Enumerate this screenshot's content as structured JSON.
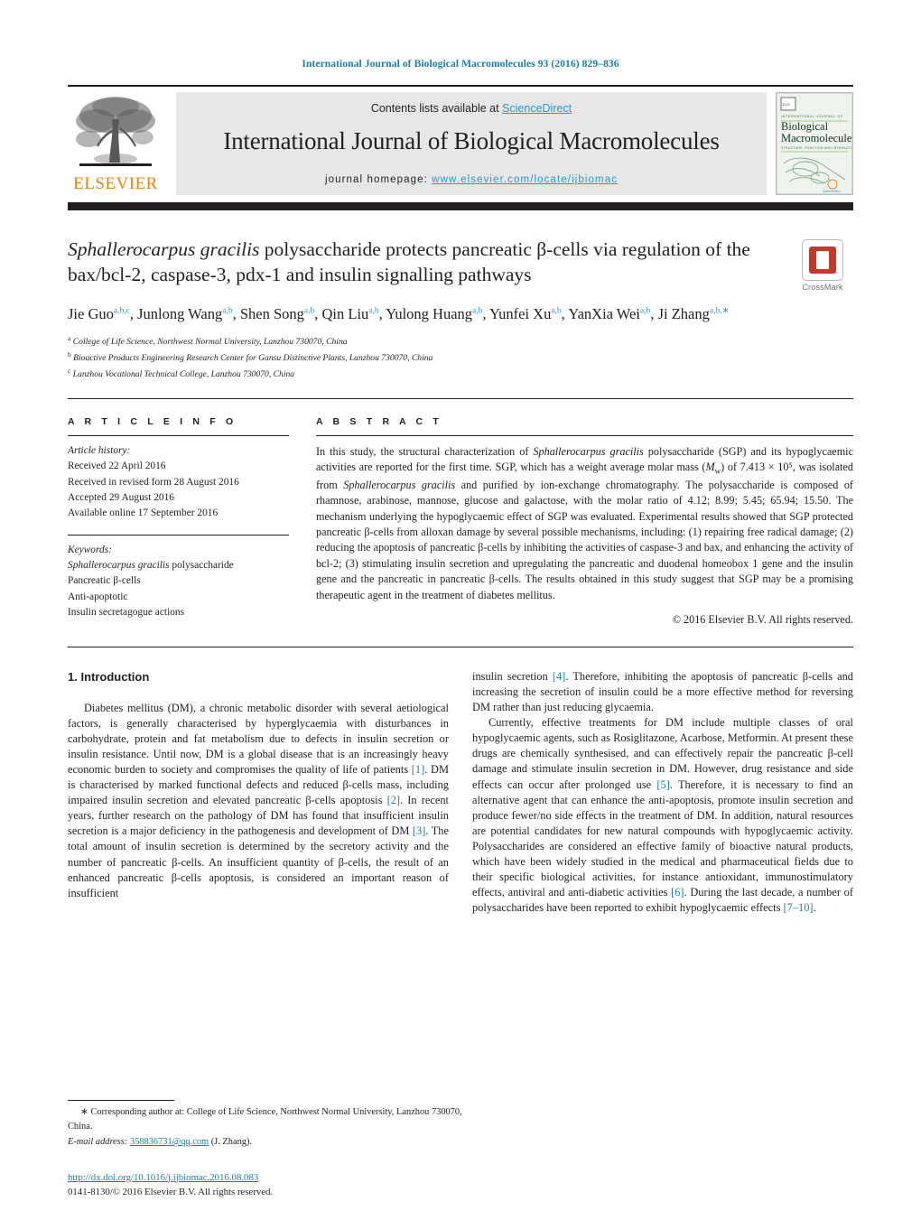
{
  "running_head": "International Journal of Biological Macromolecules 93 (2016) 829–836",
  "masthead": {
    "publisher_name": "ELSEVIER",
    "contents_prefix": "Contents lists available at ",
    "contents_link": "ScienceDirect",
    "journal_title": "International Journal of Biological Macromolecules",
    "homepage_prefix": "journal homepage: ",
    "homepage_url": "www.elsevier.com/locate/ijbiomac",
    "cover": {
      "line1": "INTERNATIONAL JOURNAL OF",
      "line2": "Biological",
      "line3": "Macromolecules",
      "line4": "STRUCTURE, FUNCTION AND INTERACTIONS",
      "footer": "ScienceDirect"
    },
    "link_color": "#2b96c8",
    "elsevier_orange": "#f0820a"
  },
  "article": {
    "crossmark_label": "CrossMark",
    "title_italic": "Sphallerocarpus gracilis",
    "title_rest": " polysaccharide protects pancreatic β-cells via regulation of the bax/bcl-2, caspase-3, pdx-1 and insulin signalling pathways",
    "authors": [
      {
        "name": "Jie Guo",
        "sup": "a,b,c"
      },
      {
        "name": "Junlong Wang",
        "sup": "a,b"
      },
      {
        "name": "Shen Song",
        "sup": "a,b"
      },
      {
        "name": "Qin Liu",
        "sup": "a,b"
      },
      {
        "name": "Yulong Huang",
        "sup": "a,b"
      },
      {
        "name": "Yunfei Xu",
        "sup": "a,b"
      },
      {
        "name": "YanXia Wei",
        "sup": "a,b"
      },
      {
        "name": "Ji Zhang",
        "sup": "a,b,∗"
      }
    ],
    "affiliations": [
      {
        "marker": "a",
        "text": "College of Life Science, Northwest Normal University, Lanzhou 730070, China"
      },
      {
        "marker": "b",
        "text": "Bioactive Products Engineering Research Center for Gansu Distinctive Plants, Lanzhou 730070, China"
      },
      {
        "marker": "c",
        "text": "Lanzhou Vocational Technical College, Lanzhou 730070, China"
      }
    ]
  },
  "article_info": {
    "heading": "A R T I C L E  I N F O",
    "history_label": "Article history:",
    "history": [
      "Received 22 April 2016",
      "Received in revised form 28 August 2016",
      "Accepted 29 August 2016",
      "Available online 17 September 2016"
    ],
    "keywords_label": "Keywords:",
    "keywords": [
      "Sphallerocarpus gracilis polysaccharide",
      "Pancreatic β-cells",
      "Anti-apoptotic",
      "Insulin secretagogue actions"
    ]
  },
  "abstract": {
    "heading": "A B S T R A C T",
    "text": "In this study, the structural characterization of Sphallerocarpus gracilis polysaccharide (SGP) and its hypoglycaemic activities are reported for the first time. SGP, which has a weight average molar mass (Mw) of 7.413 × 10⁵, was isolated from Sphallerocarpus gracilis and purified by ion-exchange chromatography. The polysaccharide is composed of rhamnose, arabinose, mannose, glucose and galactose, with the molar ratio of 4.12; 8.99; 5.45; 65.94; 15.50. The mechanism underlying the hypoglycaemic effect of SGP was evaluated. Experimental results showed that SGP protected pancreatic β-cells from alloxan damage by several possible mechanisms, including: (1) repairing free radical damage; (2) reducing the apoptosis of pancreatic β-cells by inhibiting the activities of caspase-3 and bax, and enhancing the activity of bcl-2; (3) stimulating insulin secretion and upregulating the pancreatic and duodenal homeobox 1 gene and the insulin gene and the pancreatic in pancreatic β-cells. The results obtained in this study suggest that SGP may be a promising therapeutic agent in the treatment of diabetes mellitus.",
    "copyright": "© 2016 Elsevier B.V. All rights reserved."
  },
  "body": {
    "section_number_title": "1.  Introduction",
    "left_paragraphs": [
      "Diabetes mellitus (DM), a chronic metabolic disorder with several aetiological factors, is generally characterised by hyperglycaemia with disturbances in carbohydrate, protein and fat metabolism due to defects in insulin secretion or insulin resistance. Until now, DM is a global disease that is an increasingly heavy economic burden to society and compromises the quality of life of patients [1]. DM is characterised by marked functional defects and reduced β-cells mass, including impaired insulin secretion and elevated pancreatic β-cells apoptosis [2]. In recent years, further research on the pathology of DM has found that insufficient insulin secretion is a major deficiency in the pathogenesis and development of DM [3]. The total amount of insulin secretion is determined by the secretory activity and the number of pancreatic β-cells. An insufficient quantity of β-cells, the result of an enhanced pancreatic β-cells apoptosis, is considered an important reason of insufficient"
    ],
    "right_paragraphs": [
      "insulin secretion [4]. Therefore, inhibiting the apoptosis of pancreatic β-cells and increasing the secretion of insulin could be a more effective method for reversing DM rather than just reducing glycaemia.",
      "Currently, effective treatments for DM include multiple classes of oral hypoglycaemic agents, such as Rosiglitazone, Acarbose, Metformin. At present these drugs are chemically synthesised, and can effectively repair the pancreatic β-cell damage and stimulate insulin secretion in DM. However, drug resistance and side effects can occur after prolonged use [5]. Therefore, it is necessary to find an alternative agent that can enhance the anti-apoptosis, promote insulin secretion and produce fewer/no side effects in the treatment of DM. In addition, natural resources are potential candidates for new natural compounds with hypoglycaemic activity. Polysaccharides are considered an effective family of bioactive natural products, which have been widely studied in the medical and pharmaceutical fields due to their specific biological activities, for instance antioxidant, immunostimulatory effects, antiviral and anti-diabetic activities [6]. During the last decade, a number of polysaccharides have been reported to exhibit hypoglycaemic effects [7–10]."
    ]
  },
  "footnotes": {
    "corresponding_marker": "∗",
    "corresponding_text": "Corresponding author at: College of Life Science, Northwest Normal University, Lanzhou 730070, China.",
    "email_label": "E-mail address:",
    "email": "358836731@qq.com",
    "email_owner": "(J. Zhang)."
  },
  "doi_block": {
    "doi_url": "http://dx.doi.org/10.1016/j.ijbiomac.2016.08.083",
    "issn_line": "0141-8130/© 2016 Elsevier B.V. All rights reserved."
  }
}
